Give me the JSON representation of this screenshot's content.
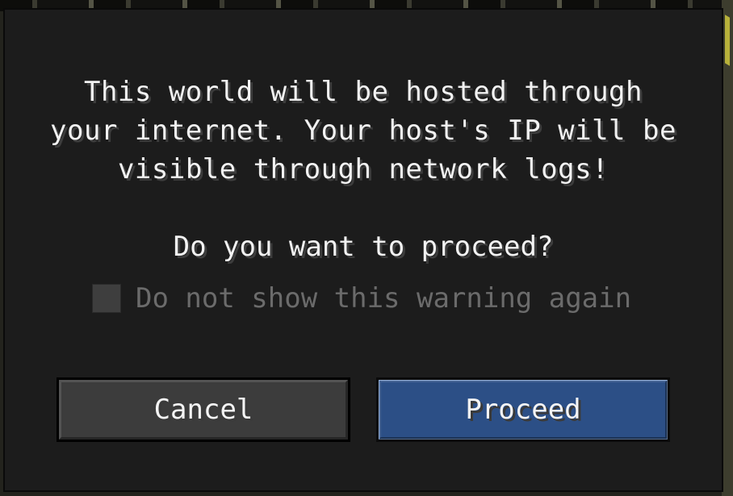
{
  "dialog": {
    "message_lines": [
      "This world will be hosted through",
      "your internet. Your host's IP will be",
      "visible through network logs!"
    ],
    "question": "Do you want to proceed?",
    "checkbox": {
      "label": "Do not show this warning again",
      "checked": false
    },
    "buttons": {
      "cancel": "Cancel",
      "proceed": "Proceed"
    }
  },
  "colors": {
    "dialog_bg": "#1c1c1c",
    "text": "#f2f2f2",
    "disabled_text": "#6b6b6b",
    "cancel_bg": "#3c3c3c",
    "proceed_bg": "#2c4f86"
  }
}
